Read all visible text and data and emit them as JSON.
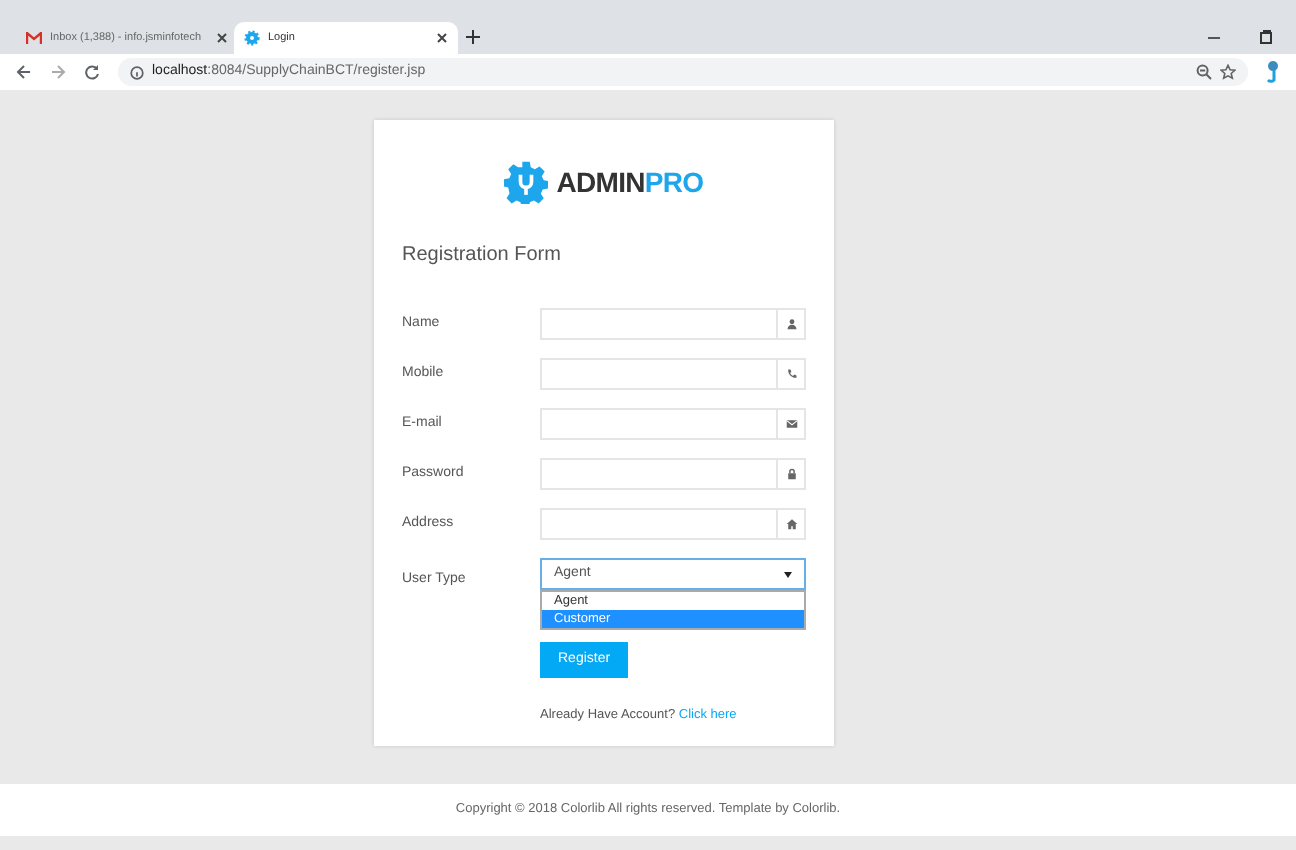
{
  "browser": {
    "tabs": [
      {
        "kind": "mail",
        "title": "Inbox (1,388) - info.jsminfotech",
        "selected": false
      },
      {
        "kind": "gear",
        "title": "Login",
        "selected": true
      }
    ],
    "url_host": "localhost",
    "url_path": ":8084/SupplyChainBCT/register.jsp"
  },
  "logo": {
    "bold": "ADMIN",
    "accent": "PRO"
  },
  "form": {
    "title": "Registration Form",
    "fields": [
      {
        "label": "Name",
        "kind": "user"
      },
      {
        "label": "Mobile",
        "kind": "phone"
      },
      {
        "label": "E-mail",
        "kind": "mail"
      },
      {
        "label": "Password",
        "kind": "lock"
      },
      {
        "label": "Address",
        "kind": "home"
      }
    ],
    "user_type": {
      "label": "User Type",
      "value": "Agent",
      "expanded": true,
      "options": [
        {
          "label": "Agent",
          "highlighted": false
        },
        {
          "label": "Customer",
          "highlighted": true
        }
      ]
    },
    "button": "Register",
    "account_text": "Already Have Account?",
    "account_link": "Click here"
  },
  "footer": "Copyright © 2018 Colorlib All rights reserved. Template by Colorlib."
}
